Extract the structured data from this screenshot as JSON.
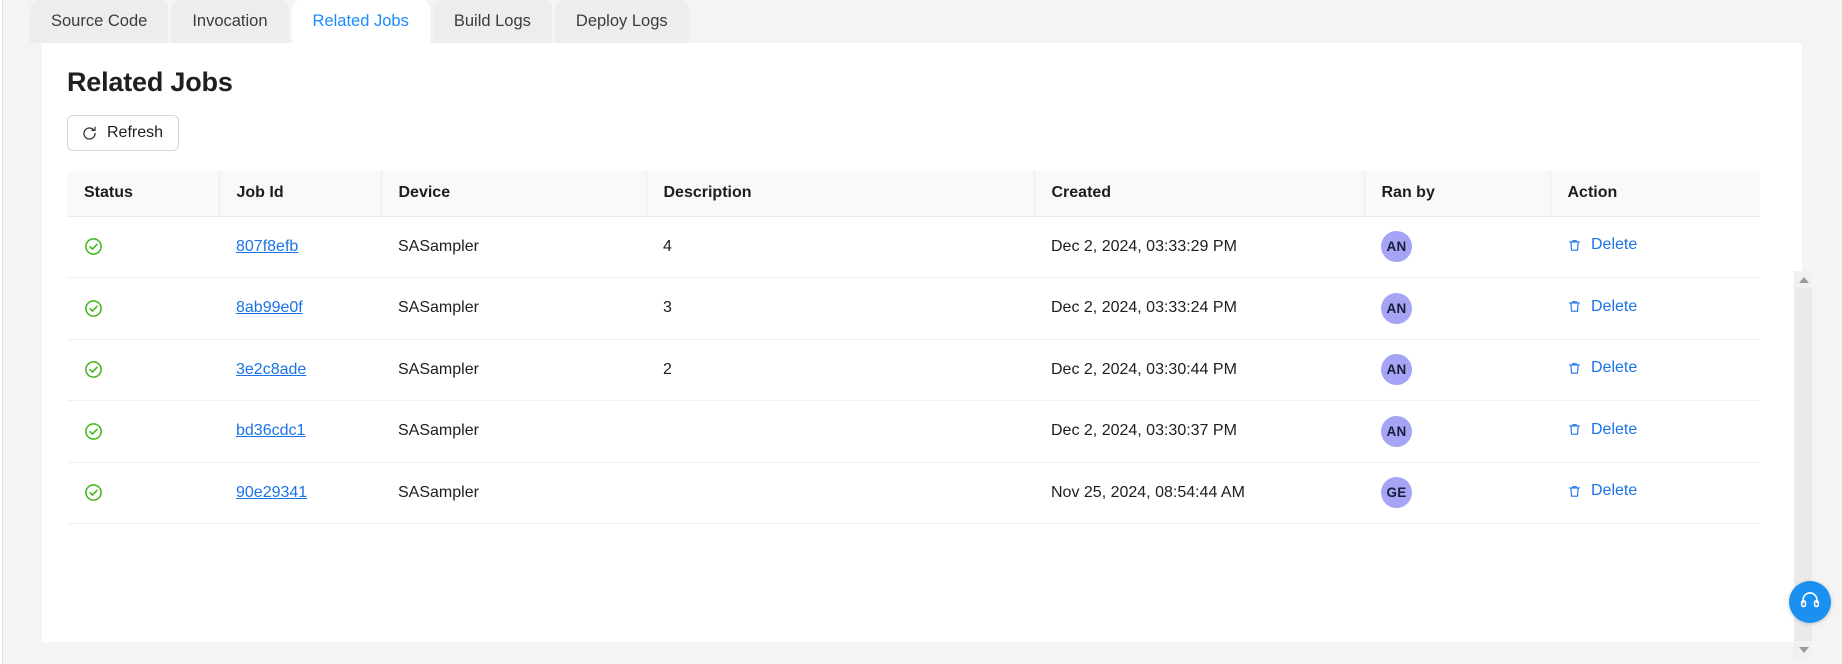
{
  "tabs": [
    {
      "label": "Source Code",
      "active": false
    },
    {
      "label": "Invocation",
      "active": false
    },
    {
      "label": "Related Jobs",
      "active": true
    },
    {
      "label": "Build Logs",
      "active": false
    },
    {
      "label": "Deploy Logs",
      "active": false
    }
  ],
  "header": {
    "title": "Related Jobs",
    "refresh_label": "Refresh",
    "refresh_icon": "refresh-icon"
  },
  "table": {
    "columns": [
      "Status",
      "Job Id",
      "Device",
      "Description",
      "Created",
      "Ran by",
      "Action"
    ],
    "rows": [
      {
        "status_icon": "check-circle-icon",
        "job_id": "807f8efb",
        "device": "SASampler",
        "description": "4",
        "created": "Dec 2, 2024, 03:33:29 PM",
        "ran_by": "AN",
        "action_label": "Delete",
        "action_icon": "trash-icon"
      },
      {
        "status_icon": "check-circle-icon",
        "job_id": "8ab99e0f",
        "device": "SASampler",
        "description": "3",
        "created": "Dec 2, 2024, 03:33:24 PM",
        "ran_by": "AN",
        "action_label": "Delete",
        "action_icon": "trash-icon"
      },
      {
        "status_icon": "check-circle-icon",
        "job_id": "3e2c8ade",
        "device": "SASampler",
        "description": "2",
        "created": "Dec 2, 2024, 03:30:44 PM",
        "ran_by": "AN",
        "action_label": "Delete",
        "action_icon": "trash-icon"
      },
      {
        "status_icon": "check-circle-icon",
        "job_id": "bd36cdc1",
        "device": "SASampler",
        "description": "",
        "created": "Dec 2, 2024, 03:30:37 PM",
        "ran_by": "AN",
        "action_label": "Delete",
        "action_icon": "trash-icon"
      },
      {
        "status_icon": "check-circle-icon",
        "job_id": "90e29341",
        "device": "SASampler",
        "description": "",
        "created": "Nov 25, 2024, 08:54:44 AM",
        "ran_by": "GE",
        "action_label": "Delete",
        "action_icon": "trash-icon"
      }
    ]
  },
  "scrollbar": {
    "up_icon": "chevron-up-icon",
    "down_icon": "chevron-down-icon"
  },
  "support": {
    "icon": "headset-icon"
  },
  "colors": {
    "accent_blue": "#1a73e8",
    "tab_active_blue": "#1a8cff",
    "status_green": "#3fb618",
    "avatar_purple": "#a5a4f5",
    "support_blue": "#1a90f0",
    "page_background": "#f4f4f4",
    "card_background": "#ffffff"
  }
}
